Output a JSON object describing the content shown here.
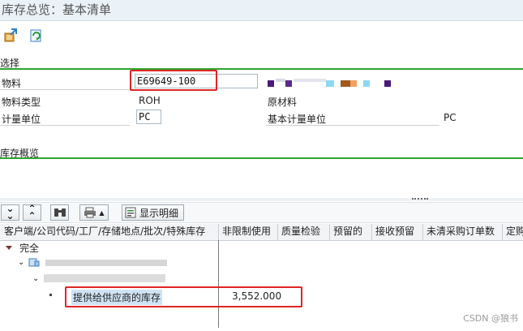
{
  "window": {
    "title": "库存总览：基本清单"
  },
  "toolbar": {
    "icons": [
      "export-icon",
      "refresh-icon"
    ]
  },
  "selection": {
    "header": "选择",
    "material": {
      "label": "物料",
      "value": "E69649-100"
    },
    "material_type": {
      "label": "物料类型",
      "value": "ROH",
      "desc": "原材料"
    },
    "unit": {
      "label": "计量单位",
      "value": "PC"
    },
    "base_unit": {
      "label": "基本计量单位",
      "value": "PC"
    }
  },
  "overview": {
    "header": "库存概览"
  },
  "alv": {
    "detail_button": "显示明细",
    "columns": [
      "客户端/公司代码/工厂/存储地点/批次/特殊库存",
      "非限制使用",
      "质量检验",
      "预留的",
      "接收预留",
      "未清采购订单数",
      "定购"
    ]
  },
  "tree": {
    "root": "完全",
    "special_label": "提供给供应商的库存",
    "special_value": "3,552.000"
  },
  "colors": {
    "accent_green": "#2ea52e",
    "highlight_red": "#e02525",
    "selected_row": "#cfe3f3"
  },
  "watermark": "CSDN @狼书"
}
